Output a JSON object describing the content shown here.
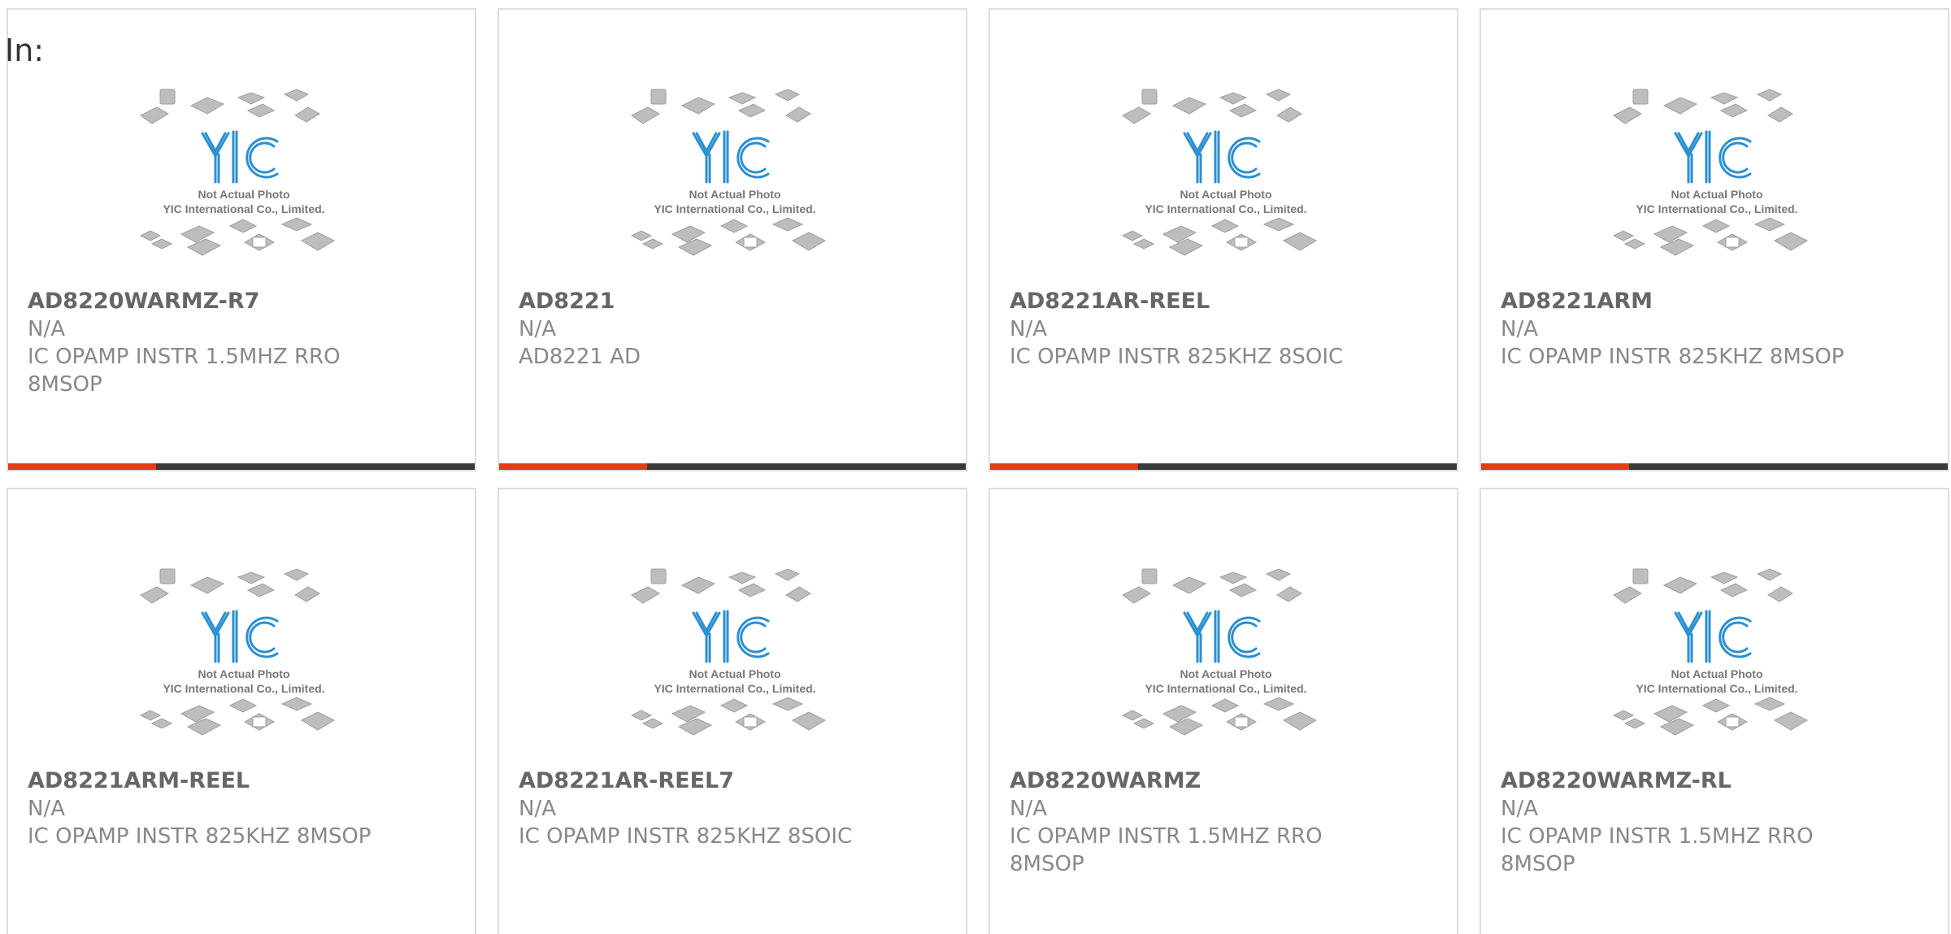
{
  "header": {
    "label": "In:"
  },
  "photo": {
    "logo_text": "YIC",
    "caption_line1": "Not Actual Photo",
    "caption_line2": "YIC International Co., Limited."
  },
  "colors": {
    "accent": "#e53a12",
    "bar": "#3a3a3a",
    "logo_blue": "#2a8fd0",
    "chip_gray": "#bdbdbd"
  },
  "products": [
    {
      "name": "AD8220WARMZ-R7",
      "manufacturer": "N/A",
      "description": "IC OPAMP INSTR 1.5MHZ RRO 8MSOP"
    },
    {
      "name": "AD8221",
      "manufacturer": "N/A",
      "description": "AD8221 AD"
    },
    {
      "name": "AD8221AR-REEL",
      "manufacturer": "N/A",
      "description": "IC OPAMP INSTR 825KHZ 8SOIC"
    },
    {
      "name": "AD8221ARM",
      "manufacturer": "N/A",
      "description": "IC OPAMP INSTR 825KHZ 8MSOP"
    },
    {
      "name": "AD8221ARM-REEL",
      "manufacturer": "N/A",
      "description": "IC OPAMP INSTR 825KHZ 8MSOP"
    },
    {
      "name": "AD8221AR-REEL7",
      "manufacturer": "N/A",
      "description": "IC OPAMP INSTR 825KHZ 8SOIC"
    },
    {
      "name": "AD8220WARMZ",
      "manufacturer": "N/A",
      "description": "IC OPAMP INSTR 1.5MHZ RRO 8MSOP"
    },
    {
      "name": "AD8220WARMZ-RL",
      "manufacturer": "N/A",
      "description": "IC OPAMP INSTR 1.5MHZ RRO 8MSOP"
    }
  ]
}
